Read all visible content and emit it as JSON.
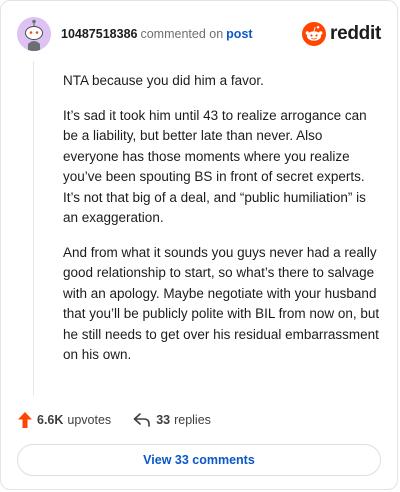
{
  "header": {
    "username": "10487518386",
    "commented_text": "commented on",
    "post_link": "post",
    "brand_name": "reddit",
    "avatar_icon": "snoo-avatar-icon",
    "logo_icon": "reddit-logo-icon"
  },
  "comment": {
    "paragraphs": [
      "NTA because you did him a favor.",
      "It’s sad it took him until 43 to realize arrogance can be a liability, but better late than never. Also everyone has those moments where you realize you’ve been spouting BS in front of secret experts. It’s not that big of a deal, and “public humiliation” is an exaggeration.",
      "And from what it sounds you guys never had a really good relationship to start, so what’s there to salvage with an apology. Maybe negotiate with your husband that you’ll be publicly polite with BIL from now on, but he still needs to get over his residual embarrassment on his own."
    ]
  },
  "actions": {
    "upvotes_count": "6.6K",
    "upvotes_label": "upvotes",
    "replies_count": "33",
    "replies_label": "replies"
  },
  "view_button": {
    "label": "View 33 comments"
  },
  "colors": {
    "accent": "#ff4500",
    "link": "#0a58ca",
    "avatar_bg": "#ddc3f4"
  }
}
